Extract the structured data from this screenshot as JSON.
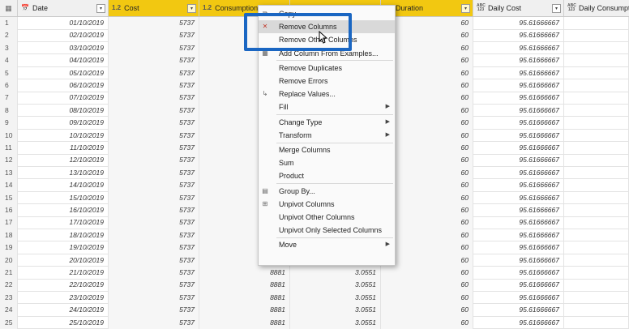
{
  "columns": [
    {
      "type_icon": "📅",
      "name": "Date"
    },
    {
      "type_icon": "1.2",
      "name": "Cost"
    },
    {
      "type_icon": "1.2",
      "name": "Consumption"
    },
    {
      "type_icon": "",
      "name": ""
    },
    {
      "type_icon": "",
      "name": "Duration"
    },
    {
      "type_icon": "ABC 123",
      "name": "Daily Cost"
    },
    {
      "type_icon": "ABC 123",
      "name": "Daily Consumption"
    }
  ],
  "rows": [
    {
      "n": "1",
      "date": "01/10/2019",
      "cost": "5737",
      "cons": "",
      "extra": "",
      "dur": "60",
      "daily": "95.61666667"
    },
    {
      "n": "2",
      "date": "02/10/2019",
      "cost": "5737",
      "cons": "",
      "extra": "",
      "dur": "60",
      "daily": "95.61666667"
    },
    {
      "n": "3",
      "date": "03/10/2019",
      "cost": "5737",
      "cons": "",
      "extra": "",
      "dur": "60",
      "daily": "95.61666667"
    },
    {
      "n": "4",
      "date": "04/10/2019",
      "cost": "5737",
      "cons": "",
      "extra": "",
      "dur": "60",
      "daily": "95.61666667"
    },
    {
      "n": "5",
      "date": "05/10/2019",
      "cost": "5737",
      "cons": "",
      "extra": "",
      "dur": "60",
      "daily": "95.61666667"
    },
    {
      "n": "6",
      "date": "06/10/2019",
      "cost": "5737",
      "cons": "",
      "extra": "",
      "dur": "60",
      "daily": "95.61666667"
    },
    {
      "n": "7",
      "date": "07/10/2019",
      "cost": "5737",
      "cons": "",
      "extra": "",
      "dur": "60",
      "daily": "95.61666667"
    },
    {
      "n": "8",
      "date": "08/10/2019",
      "cost": "5737",
      "cons": "",
      "extra": "",
      "dur": "60",
      "daily": "95.61666667"
    },
    {
      "n": "9",
      "date": "09/10/2019",
      "cost": "5737",
      "cons": "",
      "extra": "",
      "dur": "60",
      "daily": "95.61666667"
    },
    {
      "n": "10",
      "date": "10/10/2019",
      "cost": "5737",
      "cons": "",
      "extra": "",
      "dur": "60",
      "daily": "95.61666667"
    },
    {
      "n": "11",
      "date": "11/10/2019",
      "cost": "5737",
      "cons": "",
      "extra": "",
      "dur": "60",
      "daily": "95.61666667"
    },
    {
      "n": "12",
      "date": "12/10/2019",
      "cost": "5737",
      "cons": "",
      "extra": "",
      "dur": "60",
      "daily": "95.61666667"
    },
    {
      "n": "13",
      "date": "13/10/2019",
      "cost": "5737",
      "cons": "",
      "extra": "",
      "dur": "60",
      "daily": "95.61666667"
    },
    {
      "n": "14",
      "date": "14/10/2019",
      "cost": "5737",
      "cons": "",
      "extra": "",
      "dur": "60",
      "daily": "95.61666667"
    },
    {
      "n": "15",
      "date": "15/10/2019",
      "cost": "5737",
      "cons": "",
      "extra": "",
      "dur": "60",
      "daily": "95.61666667"
    },
    {
      "n": "16",
      "date": "16/10/2019",
      "cost": "5737",
      "cons": "",
      "extra": "",
      "dur": "60",
      "daily": "95.61666667"
    },
    {
      "n": "17",
      "date": "17/10/2019",
      "cost": "5737",
      "cons": "",
      "extra": "",
      "dur": "60",
      "daily": "95.61666667"
    },
    {
      "n": "18",
      "date": "18/10/2019",
      "cost": "5737",
      "cons": "",
      "extra": "",
      "dur": "60",
      "daily": "95.61666667"
    },
    {
      "n": "19",
      "date": "19/10/2019",
      "cost": "5737",
      "cons": "",
      "extra": "",
      "dur": "60",
      "daily": "95.61666667"
    },
    {
      "n": "20",
      "date": "20/10/2019",
      "cost": "5737",
      "cons": "",
      "extra": "",
      "dur": "60",
      "daily": "95.61666667"
    },
    {
      "n": "21",
      "date": "21/10/2019",
      "cost": "5737",
      "cons": "8881",
      "extra": "3.0551",
      "dur": "60",
      "daily": "95.61666667"
    },
    {
      "n": "22",
      "date": "22/10/2019",
      "cost": "5737",
      "cons": "8881",
      "extra": "3.0551",
      "dur": "60",
      "daily": "95.61666667"
    },
    {
      "n": "23",
      "date": "23/10/2019",
      "cost": "5737",
      "cons": "8881",
      "extra": "3.0551",
      "dur": "60",
      "daily": "95.61666667"
    },
    {
      "n": "24",
      "date": "24/10/2019",
      "cost": "5737",
      "cons": "8881",
      "extra": "3.0551",
      "dur": "60",
      "daily": "95.61666667"
    },
    {
      "n": "25",
      "date": "25/10/2019",
      "cost": "5737",
      "cons": "8881",
      "extra": "3.0551",
      "dur": "60",
      "daily": "95.61666667"
    }
  ],
  "context_menu": {
    "items": [
      {
        "icon": "copy-icon",
        "glyph": "⧉",
        "label": "Copy",
        "submenu": false
      },
      {
        "icon": "remove-columns-icon",
        "glyph": "✕",
        "label": "Remove Columns",
        "submenu": false,
        "hover": true
      },
      {
        "icon": "",
        "glyph": "",
        "label": "Remove Other Columns",
        "submenu": false
      },
      {
        "icon": "add-column-icon",
        "glyph": "▦",
        "label": "Add Column From Examples...",
        "submenu": false,
        "sep_after": true
      },
      {
        "icon": "",
        "glyph": "",
        "label": "Remove Duplicates",
        "submenu": false
      },
      {
        "icon": "",
        "glyph": "",
        "label": "Remove Errors",
        "submenu": false
      },
      {
        "icon": "replace-values-icon",
        "glyph": "↳",
        "label": "Replace Values...",
        "submenu": false
      },
      {
        "icon": "",
        "glyph": "",
        "label": "Fill",
        "submenu": true,
        "sep_after": true
      },
      {
        "icon": "",
        "glyph": "",
        "label": "Change Type",
        "submenu": true
      },
      {
        "icon": "",
        "glyph": "",
        "label": "Transform",
        "submenu": true,
        "sep_after": true
      },
      {
        "icon": "",
        "glyph": "",
        "label": "Merge Columns",
        "submenu": false
      },
      {
        "icon": "",
        "glyph": "",
        "label": "Sum",
        "submenu": false
      },
      {
        "icon": "",
        "glyph": "",
        "label": "Product",
        "submenu": false,
        "sep_after": true
      },
      {
        "icon": "group-by-icon",
        "glyph": "▤",
        "label": "Group By...",
        "submenu": false
      },
      {
        "icon": "unpivot-icon",
        "glyph": "⊞",
        "label": "Unpivot Columns",
        "submenu": false
      },
      {
        "icon": "",
        "glyph": "",
        "label": "Unpivot Other Columns",
        "submenu": false
      },
      {
        "icon": "",
        "glyph": "",
        "label": "Unpivot Only Selected Columns",
        "submenu": false,
        "sep_after": true
      },
      {
        "icon": "",
        "glyph": "",
        "label": "Move",
        "submenu": true
      }
    ]
  },
  "colors": {
    "selected_header": "#f2c811",
    "highlight": "#1a66c2"
  }
}
